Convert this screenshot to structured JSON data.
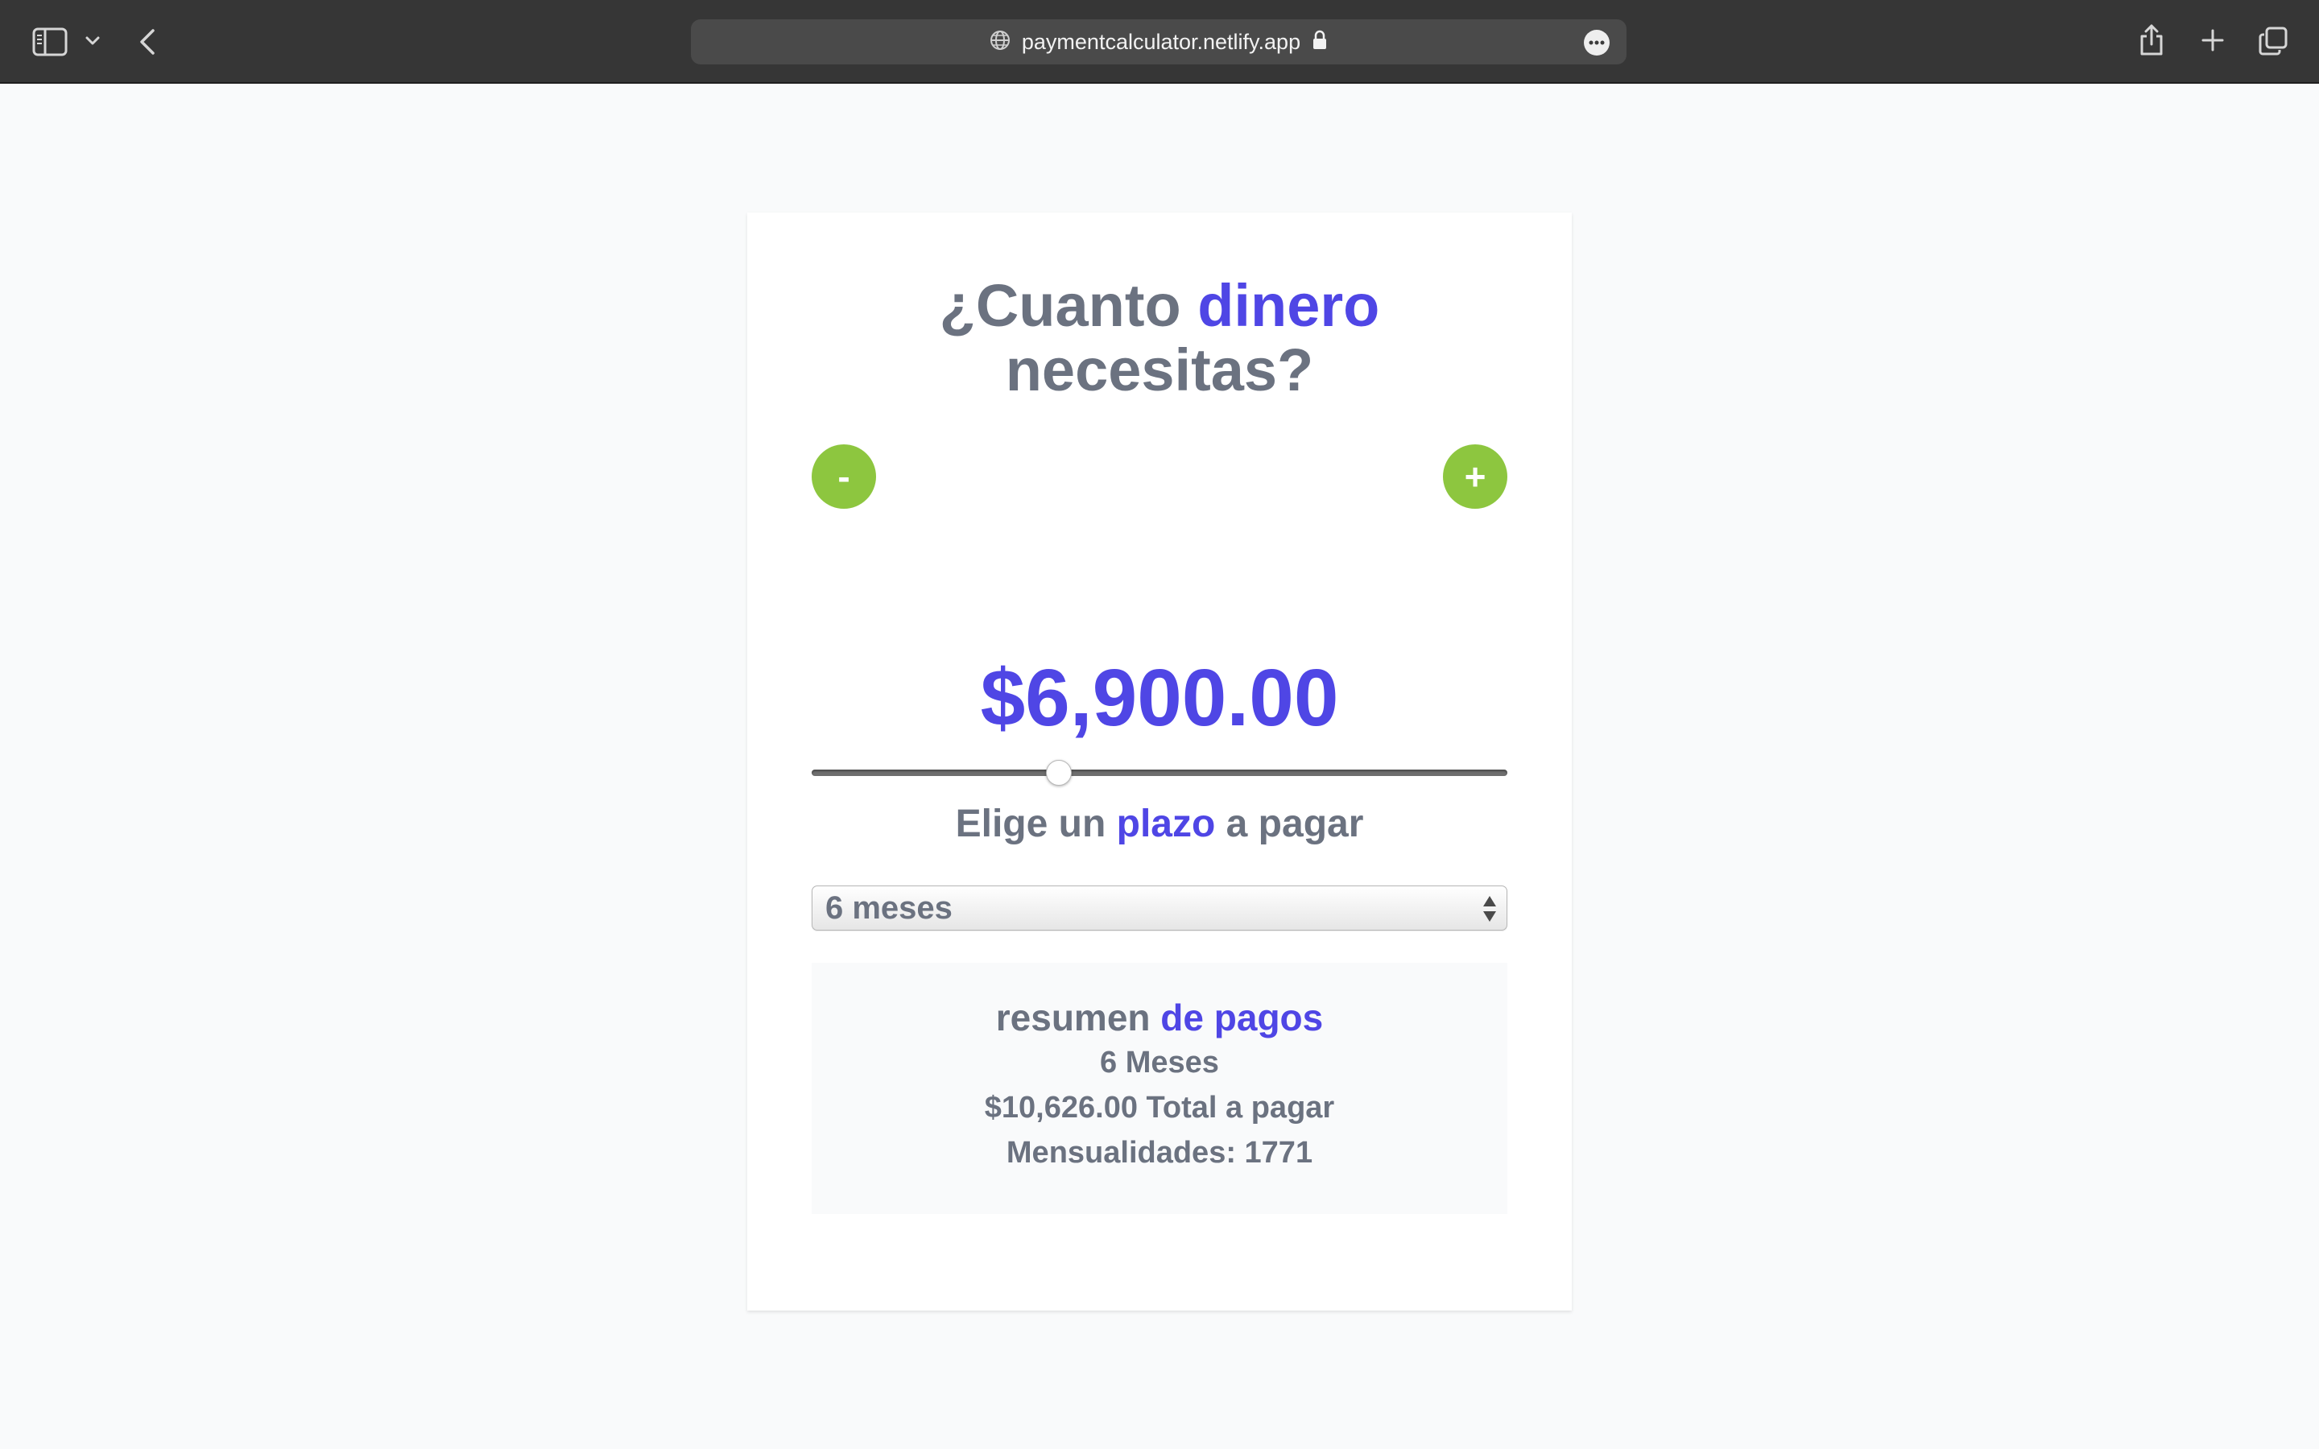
{
  "browser": {
    "url": "paymentcalculator.netlify.app",
    "icons": {
      "sidebar": "sidebar-icon",
      "chevron": "chevron-down-icon",
      "back": "back-icon",
      "globe": "globe-icon",
      "lock": "lock-icon",
      "more": "more-icon",
      "share": "share-icon",
      "new_tab": "plus-icon",
      "tabs": "tabs-icon"
    }
  },
  "calculator": {
    "title": {
      "part1": "¿Cuanto",
      "accent": "dinero",
      "part2": "necesitas?"
    },
    "decrease_label": "-",
    "increase_label": "+",
    "slider_fraction": 0.35,
    "amount": "$6,900.00",
    "term_heading": {
      "part1": "Elige un",
      "accent": "plazo",
      "part2": "a pagar"
    },
    "term_selected": "6 meses",
    "summary": {
      "title_part1": "resumen",
      "title_accent": "de pagos",
      "months": "6 Meses",
      "total": "$10,626.00 Total a pagar",
      "monthly": "Mensualidades: 1771"
    }
  },
  "colors": {
    "accent": "#4f46e5",
    "text": "#6b7280",
    "button": "#8dc63f",
    "background": "#f9fafb",
    "toolbar": "#363636"
  }
}
